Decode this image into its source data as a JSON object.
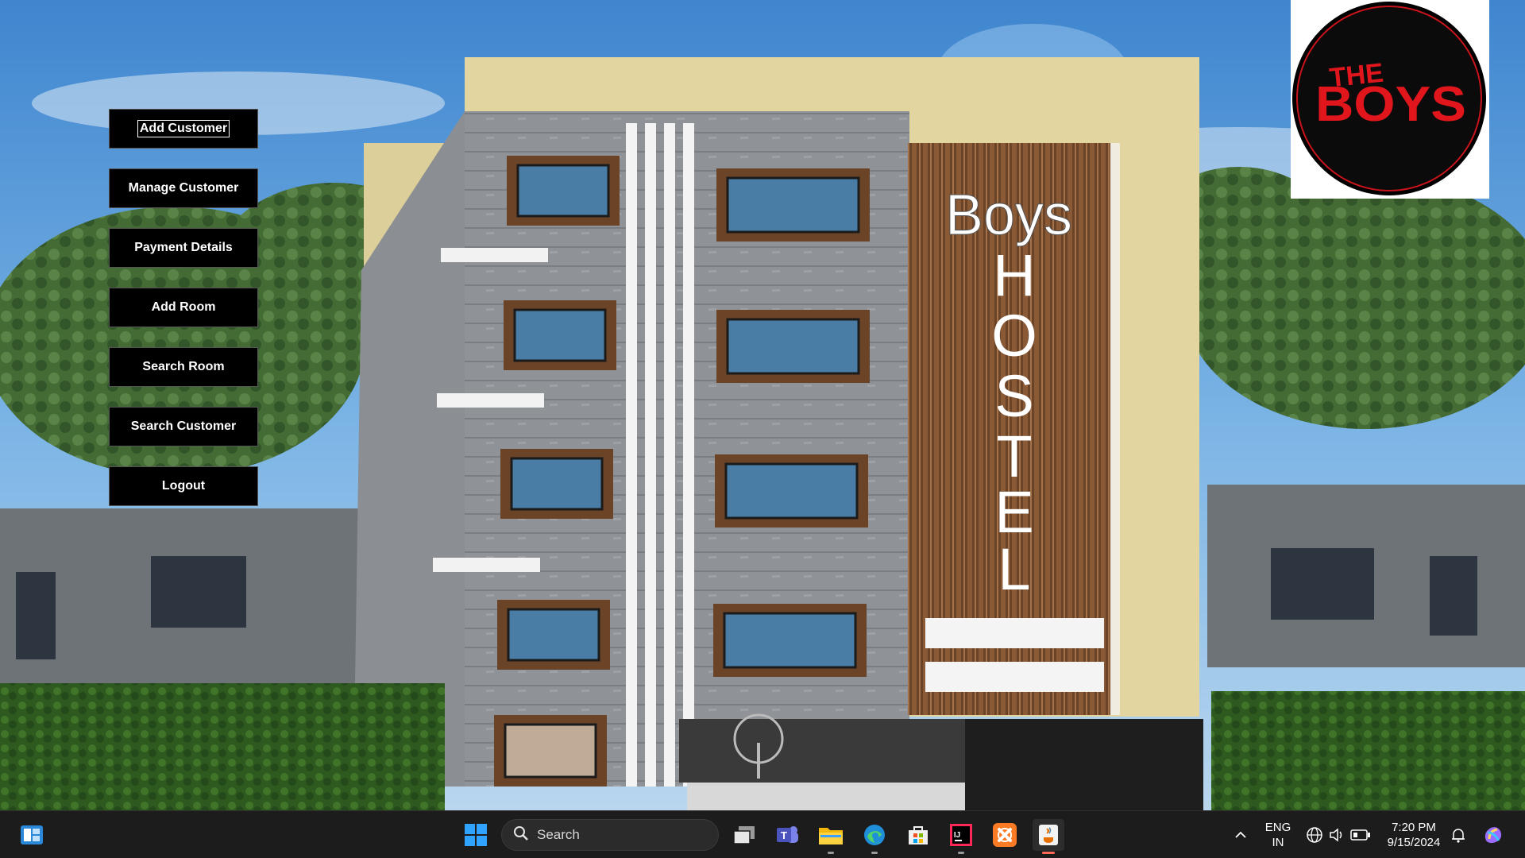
{
  "menu": {
    "add_customer": "Add Customer",
    "manage_customer": "Manage Customer",
    "payment_details": "Payment Details",
    "add_room": "Add Room",
    "search_room": "Search Room",
    "search_customer": "Search Customer",
    "logout": "Logout"
  },
  "sign": {
    "line1": "Boys",
    "letters": [
      "H",
      "O",
      "S",
      "T",
      "E",
      "L"
    ]
  },
  "logo": {
    "line1": "THE",
    "line2": "BOYS"
  },
  "taskbar": {
    "search_placeholder": "Search",
    "language": "ENG",
    "region": "IN",
    "time": "7:20 PM",
    "date": "9/15/2024",
    "pinned_icons": [
      "task-view-icon",
      "teams-icon",
      "file-explorer-icon",
      "edge-icon",
      "store-icon",
      "intellij-icon",
      "xampp-icon",
      "java-icon"
    ]
  },
  "colors": {
    "button_bg": "#000000",
    "button_text": "#ffffff",
    "taskbar_bg": "#1c1c1c",
    "logo_red": "#e0161c"
  }
}
